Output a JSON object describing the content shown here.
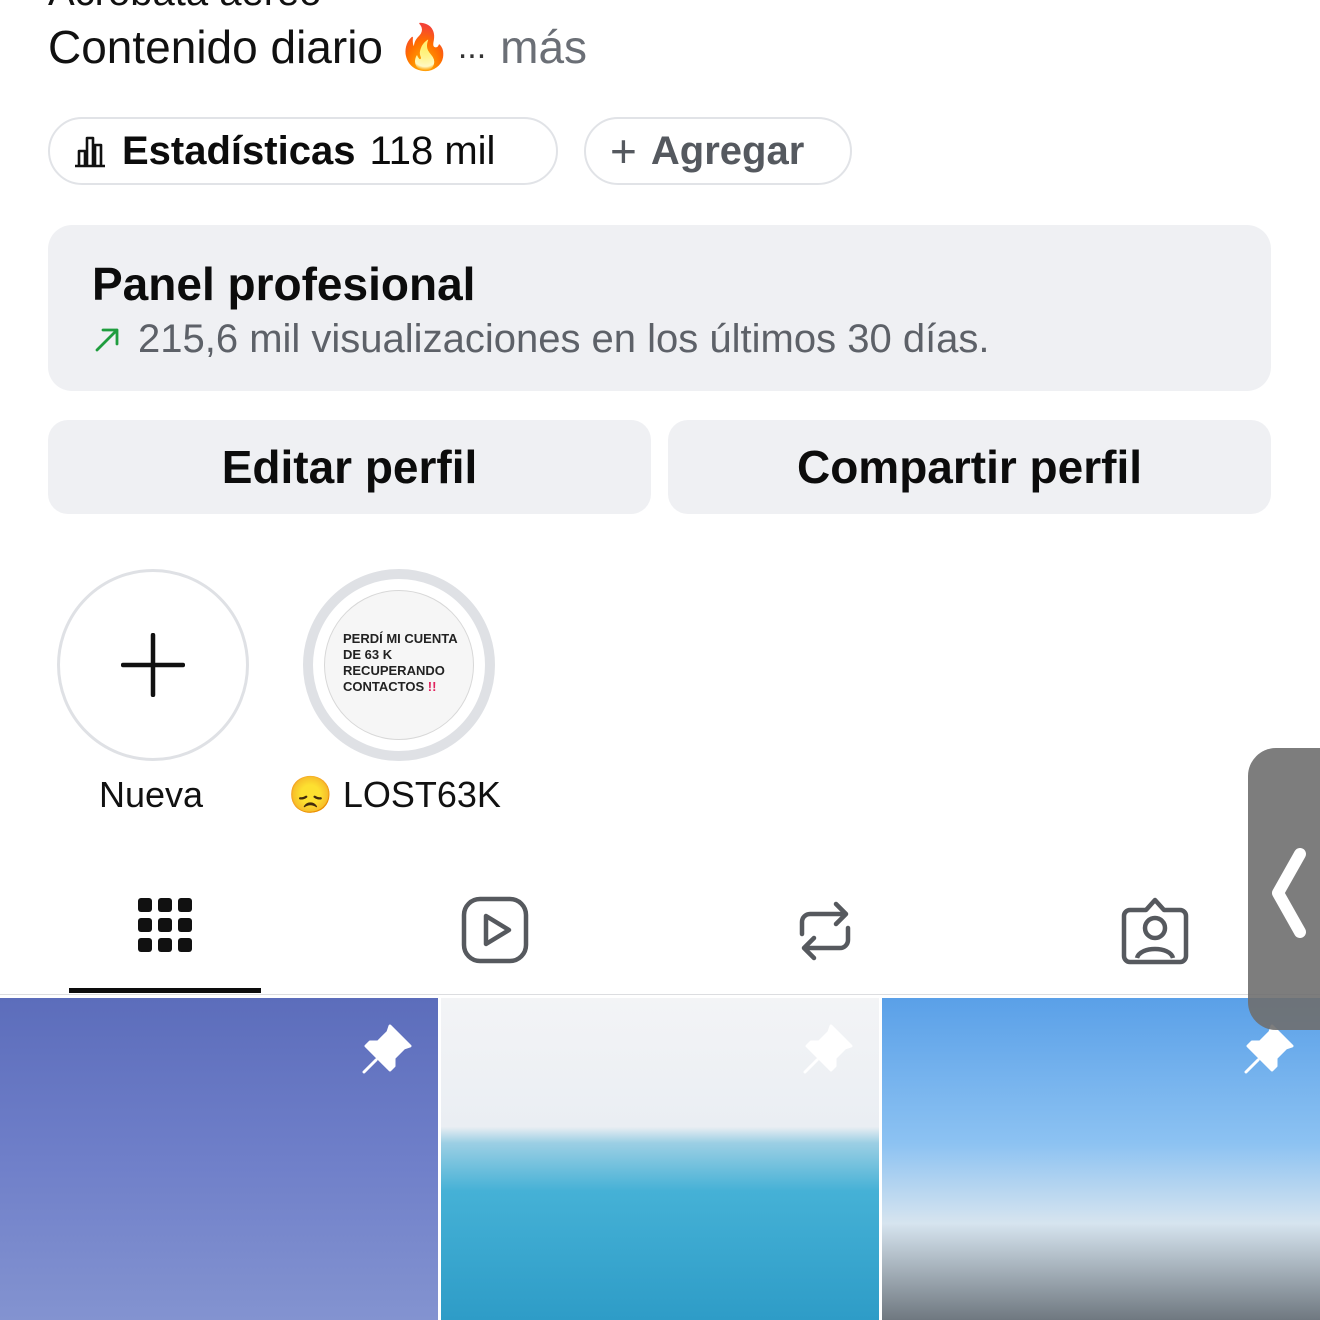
{
  "bio": {
    "cut_line": "Acróbata aéreo",
    "line": "Contenido diario",
    "line_emoji": "🔥",
    "ellipsis": "...",
    "more": "más"
  },
  "pills": {
    "stats_label": "Estadísticas",
    "stats_value": "118 mil",
    "add_label": "Agregar"
  },
  "panel": {
    "title": "Panel profesional",
    "subtitle": "215,6 mil visualizaciones en los últimos 30 días."
  },
  "buttons": {
    "edit": "Editar perfil",
    "share": "Compartir perfil"
  },
  "highlights": [
    {
      "label": "Nueva"
    },
    {
      "label": "😞 LOST63K",
      "cover_lines": [
        "PERDÍ MI CUENTA",
        "DE 63 K",
        "RECUPERANDO",
        "CONTACTOS"
      ],
      "cover_bang": "!!"
    }
  ],
  "tabs": [
    {
      "name": "posts-grid",
      "icon": "grid-icon",
      "active": true
    },
    {
      "name": "reels",
      "icon": "reels-play-icon",
      "active": false
    },
    {
      "name": "reposts",
      "icon": "repost-icon",
      "active": false
    },
    {
      "name": "tagged",
      "icon": "tagged-person-icon",
      "active": false
    }
  ],
  "posts": [
    {
      "pinned": true,
      "icon": "pin-icon"
    },
    {
      "pinned": true,
      "icon": "pin-icon"
    },
    {
      "pinned": true,
      "icon": "pin-icon"
    }
  ],
  "colors": {
    "panel_bg": "#eff0f3",
    "trend_arrow": "#1f9d3e",
    "more_text": "#6b6f76"
  }
}
